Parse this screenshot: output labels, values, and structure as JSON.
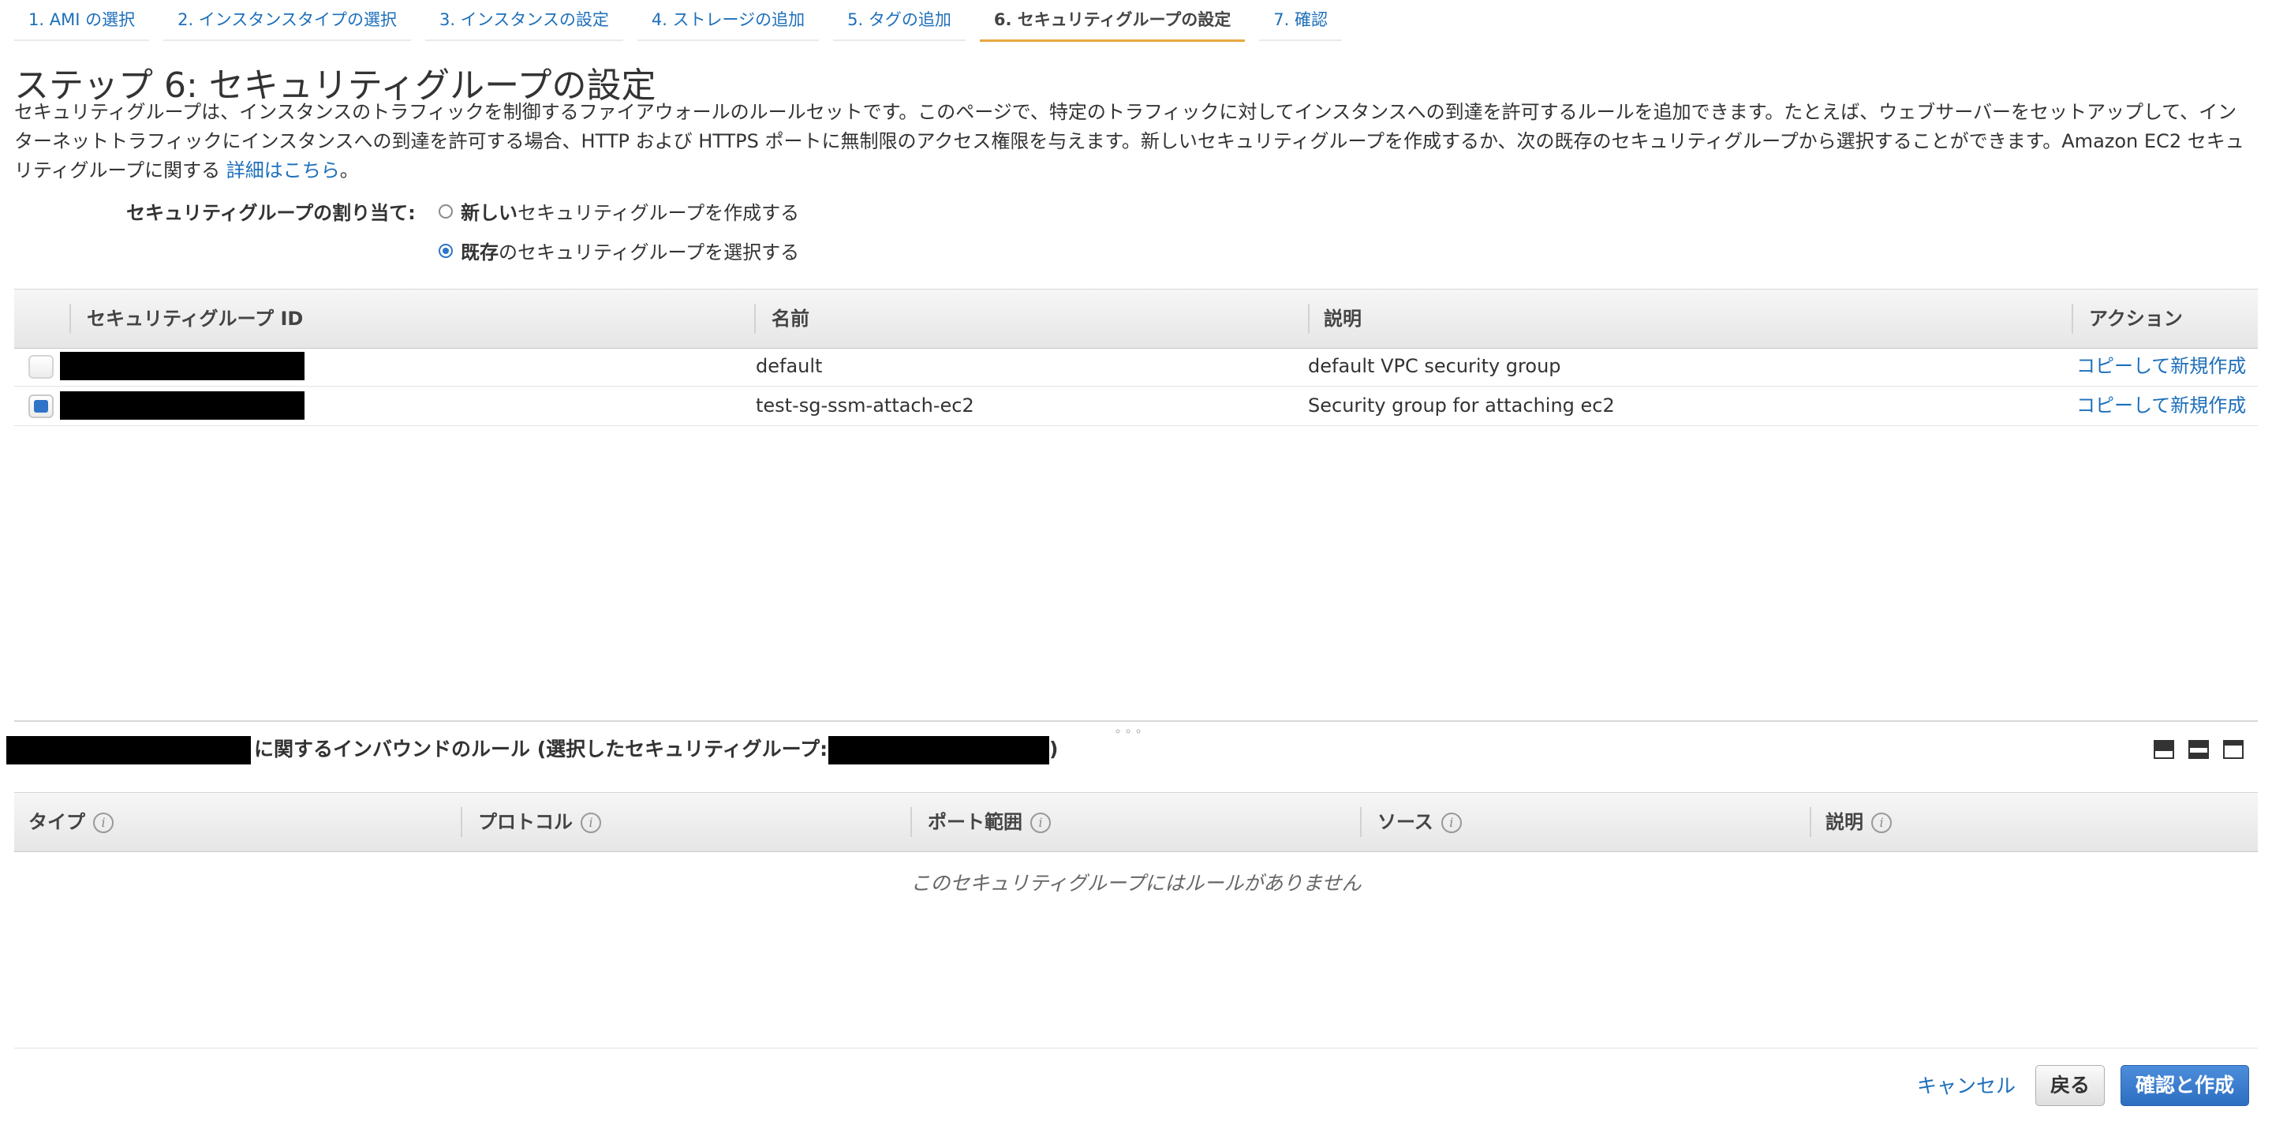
{
  "tabs": [
    {
      "label": "1. AMI の選択"
    },
    {
      "label": "2. インスタンスタイプの選択"
    },
    {
      "label": "3. インスタンスの設定"
    },
    {
      "label": "4. ストレージの追加"
    },
    {
      "label": "5. タグの追加"
    },
    {
      "label": "6. セキュリティグループの設定"
    },
    {
      "label": "7. 確認"
    }
  ],
  "header": {
    "title": "ステップ 6: セキュリティグループの設定",
    "intro": "セキュリティグループは、インスタンスのトラフィックを制御するファイアウォールのルールセットです。このページで、特定のトラフィックに対してインスタンスへの到達を許可するルールを追加できます。たとえば、ウェブサーバーをセットアップして、インターネットトラフィックにインスタンスへの到達を許可する場合、HTTP および HTTPS ポートに無制限のアクセス権限を与えます。新しいセキュリティグループを作成するか、次の既存のセキュリティグループから選択することができます。Amazon EC2 セキュリティグループに関する",
    "learn_more": "詳細はこちら",
    "intro_end": "。"
  },
  "assign": {
    "label": "セキュリティグループの割り当て:",
    "option_new_bold": "新しい",
    "option_new_rest": "セキュリティグループを作成する",
    "option_existing_bold": "既存",
    "option_existing_rest": "のセキュリティグループを選択する",
    "selected": "existing"
  },
  "sg_table": {
    "columns": {
      "id": "セキュリティグループ ID",
      "name": "名前",
      "description": "説明",
      "action": "アクション"
    },
    "rows": [
      {
        "name": "default",
        "description": "default VPC security group",
        "action": "コピーして新規作成",
        "checked": false
      },
      {
        "name": "test-sg-ssm-attach-ec2",
        "description": "Security group for attaching ec2",
        "action": "コピーして新規作成",
        "checked": true
      }
    ]
  },
  "inbound": {
    "title_mid": "に関するインバウンドのルール (選択したセキュリティグループ:",
    "title_end": ")",
    "grip": "∘∘∘",
    "columns": {
      "type": "タイプ",
      "protocol": "プロトコル",
      "port_range": "ポート範囲",
      "source": "ソース",
      "description": "説明"
    },
    "info_glyph": "i",
    "empty_message": "このセキュリティグループにはルールがありません"
  },
  "footer": {
    "cancel": "キャンセル",
    "back": "戻る",
    "review_and_launch": "確認と作成"
  },
  "colors": {
    "link": "#1d6fbb",
    "active_tab_underline": "#e8a73f",
    "primary_button": "#2c6ec1",
    "redaction": "#000000"
  }
}
